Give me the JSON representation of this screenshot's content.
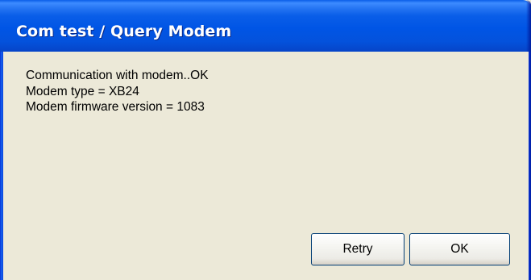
{
  "window": {
    "title": "Com test / Query Modem"
  },
  "message": {
    "lines": [
      "Communication with modem..OK",
      "Modem type = XB24",
      "Modem firmware version = 1083"
    ]
  },
  "buttons": {
    "retry_label": "Retry",
    "ok_label": "OK"
  },
  "colors": {
    "titlebar_blue": "#0055e5",
    "dialog_face": "#ece9d8"
  }
}
